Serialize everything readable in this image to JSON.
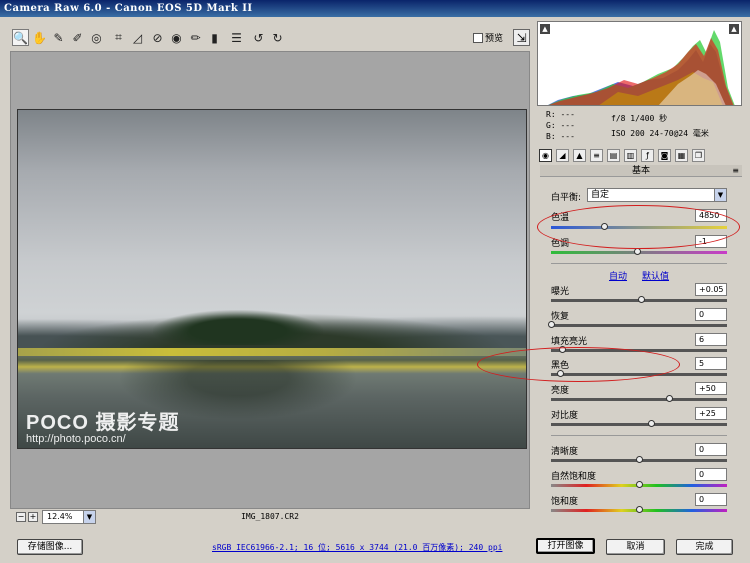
{
  "window": {
    "title": "Camera Raw 6.0 -  Canon EOS 5D Mark II"
  },
  "toolbar": {
    "tools": [
      {
        "icon": "zoom-icon",
        "glyph": "🔍"
      },
      {
        "icon": "hand-icon",
        "glyph": "✋"
      },
      {
        "icon": "white-balance-icon",
        "glyph": "✎"
      },
      {
        "icon": "color-sampler-icon",
        "glyph": "✐"
      },
      {
        "icon": "target-adjust-icon",
        "glyph": "◎"
      },
      {
        "icon": "crop-icon",
        "glyph": "⌗"
      },
      {
        "icon": "straighten-icon",
        "glyph": "◿"
      },
      {
        "icon": "spot-removal-icon",
        "glyph": "⊘"
      },
      {
        "icon": "red-eye-icon",
        "glyph": "◉"
      },
      {
        "icon": "adjustment-brush-icon",
        "glyph": "✏"
      },
      {
        "icon": "graduated-filter-icon",
        "glyph": "▮"
      },
      {
        "icon": "preferences-icon",
        "glyph": "☰"
      },
      {
        "icon": "rotate-ccw-icon",
        "glyph": "↺"
      },
      {
        "icon": "rotate-cw-icon",
        "glyph": "↻"
      }
    ],
    "preview_label": "预览"
  },
  "canvas": {
    "watermark_main": "POCO 摄影专题",
    "watermark_url": "http://photo.poco.cn/",
    "zoom_value": "12.4%",
    "filename": "IMG_1807.CR2"
  },
  "readout": {
    "r": "R:  ---",
    "g": "G:  ---",
    "b": "B:  ---",
    "camera_line1": "f/8   1/400 秒",
    "camera_line2": "ISO 200  24-70@24 毫米"
  },
  "panel": {
    "title": "基本",
    "white_balance_label": "白平衡:",
    "white_balance_value": "自定",
    "auto_label": "自动",
    "default_label": "默认值",
    "sliders": [
      {
        "key": "temperature",
        "label": "色温",
        "value": "4850",
        "pos": 0.3
      },
      {
        "key": "tint",
        "label": "色调",
        "value": "-1",
        "pos": 0.49
      },
      {
        "key": "exposure",
        "label": "曝光",
        "value": "+0.05",
        "pos": 0.51
      },
      {
        "key": "recovery",
        "label": "恢复",
        "value": "0",
        "pos": 0.0
      },
      {
        "key": "fill-light",
        "label": "填充亮光",
        "value": "6",
        "pos": 0.06
      },
      {
        "key": "blacks",
        "label": "黑色",
        "value": "5",
        "pos": 0.05
      },
      {
        "key": "brightness",
        "label": "亮度",
        "value": "+50",
        "pos": 0.67
      },
      {
        "key": "contrast",
        "label": "对比度",
        "value": "+25",
        "pos": 0.57
      },
      {
        "key": "clarity",
        "label": "清晰度",
        "value": "0",
        "pos": 0.5
      },
      {
        "key": "vibrance",
        "label": "自然饱和度",
        "value": "0",
        "pos": 0.5
      },
      {
        "key": "saturation",
        "label": "饱和度",
        "value": "0",
        "pos": 0.5
      }
    ]
  },
  "bottom": {
    "save_label": "存储图像...",
    "info_text": "sRGB IEC61966-2.1; 16 位; 5616 x 3744 (21.0 百万像素); 240 ppi",
    "open_label": "打开图像",
    "cancel_label": "取消",
    "done_label": "完成"
  },
  "colors": {
    "annotation": "#d21e1e",
    "link": "#0000cc",
    "titlebar": "#0a246a"
  }
}
